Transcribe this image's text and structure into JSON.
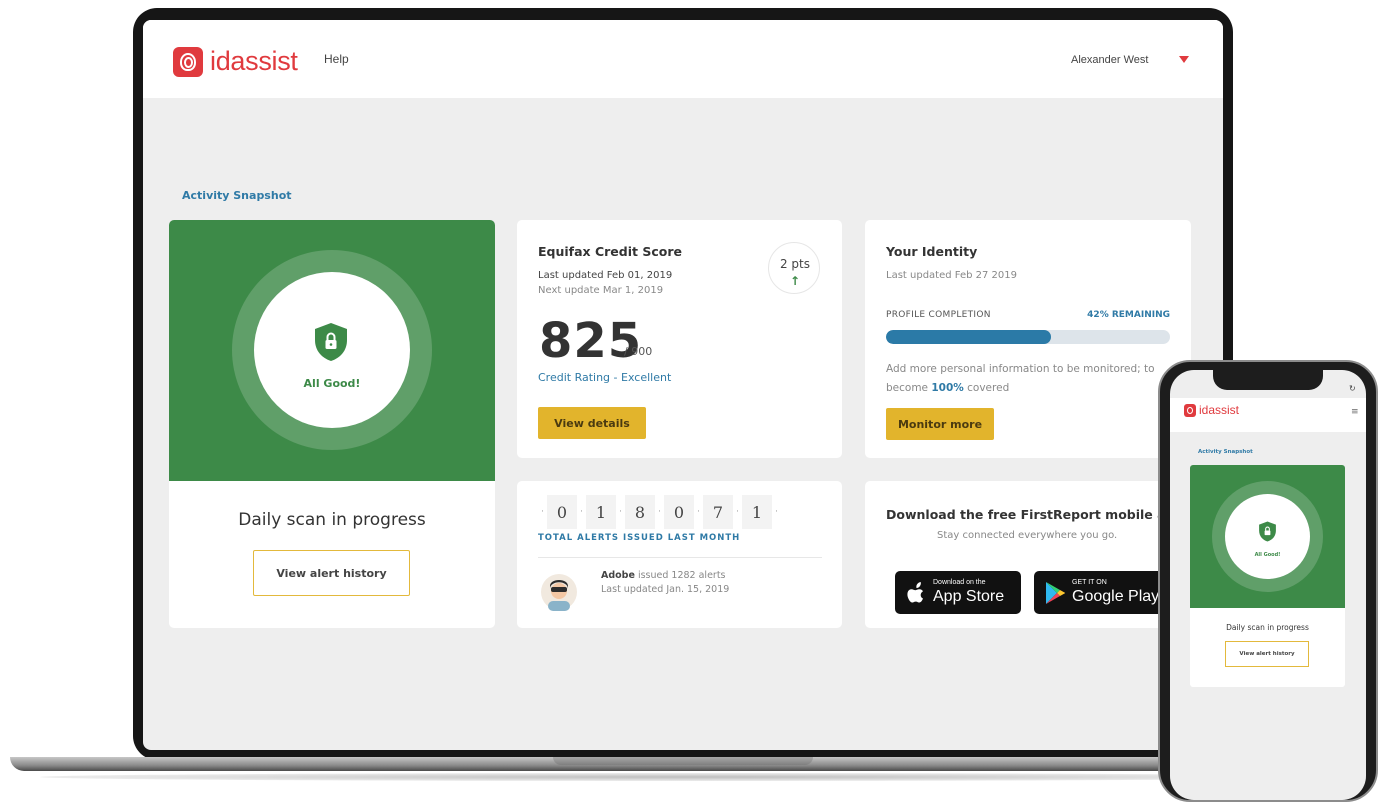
{
  "header": {
    "logo_text": "idassist",
    "help_label": "Help",
    "user_name": "Alexander West"
  },
  "section_title": "Activity Snapshot",
  "scan_card": {
    "status_text": "All Good!",
    "title": "Daily scan in progress",
    "button_label": "View alert history"
  },
  "credit_card": {
    "title": "Equifax Credit Score",
    "last_updated": "Last updated Feb 01, 2019",
    "next_update": "Next update Mar 1, 2019",
    "points_change": "2 pts",
    "points_arrow": "↑",
    "score": "825",
    "score_max": "/ 900",
    "rating": "Credit Rating - Excellent",
    "button_label": "View details"
  },
  "identity_card": {
    "title": "Your Identity",
    "last_updated": "Last updated Feb 27 2019",
    "profile_label": "PROFILE COMPLETION",
    "remaining_label": "42% REMAINING",
    "completion_fraction": 0.58,
    "desc_before": "Add more personal information to be monitored; to become ",
    "desc_highlight": "100%",
    "desc_after": " covered",
    "button_label": "Monitor more"
  },
  "alerts_card": {
    "digits": [
      "0",
      "1",
      "8",
      "0",
      "7",
      "1"
    ],
    "label": "TOTAL ALERTS ISSUED LAST MONTH",
    "company": "Adobe",
    "issued_text": " issued 1282 alerts",
    "last_updated": "Last updated Jan. 15, 2019"
  },
  "app_card": {
    "title": "Download the free FirstReport mobile app",
    "subtitle": "Stay connected everywhere you go.",
    "apple_small": "Download on the",
    "apple_big": "App Store",
    "google_small": "GET IT ON",
    "google_big": "Google Play"
  },
  "phone": {
    "logo_text": "idassist",
    "section_title": "Activity Snapshot",
    "status_text": "All Good!",
    "scan_title": "Daily scan in progress",
    "button_label": "View alert history"
  },
  "colors": {
    "brand_red": "#e03a3e",
    "success_green": "#3d8a48",
    "accent_blue": "#2f7aa6",
    "button_gold": "#e2b42c"
  },
  "icons": {
    "logo": "fingerprint-logo-icon",
    "user_menu": "caret-down-icon",
    "status": "shield-lock-icon",
    "apple": "apple-icon",
    "google": "google-play-icon",
    "menu": "hamburger-icon",
    "refresh": "refresh-icon"
  }
}
